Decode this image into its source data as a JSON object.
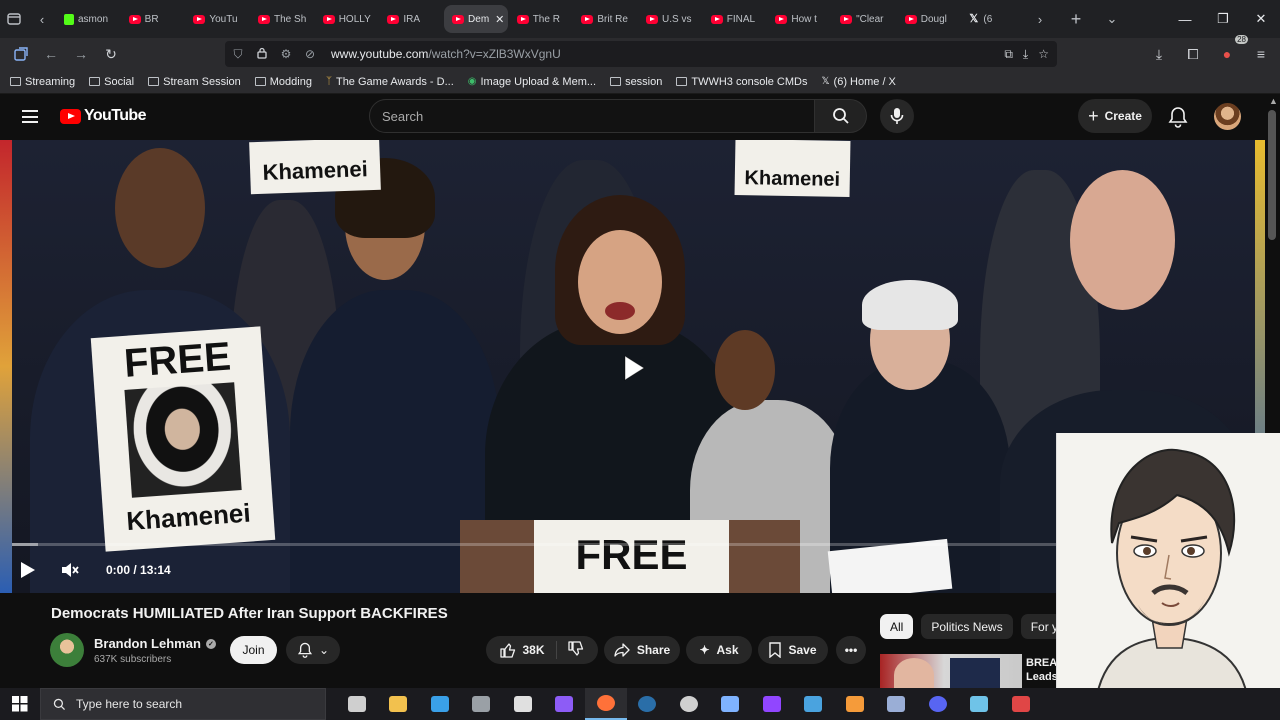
{
  "browser": {
    "tabs": [
      {
        "label": "asmon",
        "favicon": "kick-icon"
      },
      {
        "label": "BR",
        "favicon": "youtube-icon"
      },
      {
        "label": "YouTu",
        "favicon": "youtube-icon"
      },
      {
        "label": "The Sh",
        "favicon": "youtube-icon"
      },
      {
        "label": "HOLLY",
        "favicon": "youtube-icon"
      },
      {
        "label": "IRA",
        "favicon": "youtube-icon"
      },
      {
        "label": "Dem",
        "favicon": "youtube-icon",
        "active": true
      },
      {
        "label": "The R",
        "favicon": "youtube-icon"
      },
      {
        "label": "Brit Re",
        "favicon": "youtube-icon"
      },
      {
        "label": "U.S vs",
        "favicon": "youtube-icon"
      },
      {
        "label": "FINAL",
        "favicon": "youtube-icon"
      },
      {
        "label": "How t",
        "favicon": "youtube-icon"
      },
      {
        "label": "\"Clear",
        "favicon": "youtube-icon"
      },
      {
        "label": "Dougl",
        "favicon": "youtube-icon"
      },
      {
        "label": "(6",
        "favicon": "x-icon"
      }
    ],
    "url_host": "www.youtube.com",
    "url_path": "/watch?v=xZlB3WxVgnU",
    "extension_badge": "28",
    "bookmarks": [
      {
        "label": "Streaming",
        "icon": "folder-icon"
      },
      {
        "label": "Social",
        "icon": "folder-icon"
      },
      {
        "label": "Stream Session",
        "icon": "folder-icon"
      },
      {
        "label": "Modding",
        "icon": "folder-icon"
      },
      {
        "label": "The Game Awards - D...",
        "icon": "game-awards-icon"
      },
      {
        "label": "Image Upload & Mem...",
        "icon": "image-upload-icon"
      },
      {
        "label": "session",
        "icon": "folder-icon"
      },
      {
        "label": "TWWH3 console CMDs",
        "icon": "folder-icon"
      },
      {
        "label": "(6) Home / X",
        "icon": "x-icon"
      }
    ]
  },
  "youtube": {
    "logo_text": "YouTube",
    "search_placeholder": "Search",
    "create_label": "Create",
    "video": {
      "time_display": "0:00 / 13:14",
      "progress_fraction": 0.0,
      "sign_top_left": "Khamenei",
      "sign_top_right": "Khamenei",
      "sign_main_word": "FREE",
      "sign_main_name": "Khamenei",
      "podium_word": "FREE"
    },
    "title": "Democrats HUMILIATED After Iran Support BACKFIRES",
    "channel": {
      "name": "Brandon Lehman",
      "subscribers": "637K subscribers",
      "join_label": "Join"
    },
    "actions": {
      "likes": "38K",
      "share": "Share",
      "ask": "Ask",
      "save": "Save"
    },
    "chips": [
      "All",
      "Politics News",
      "For y"
    ],
    "recommended": {
      "title_line1": "BREA",
      "title_line2": "Leads"
    }
  },
  "taskbar": {
    "search_placeholder": "Type here to search"
  },
  "colors": {
    "youtube_red": "#ff0000",
    "page_bg": "#0f0f0f",
    "chip_active": "#f1f1f1"
  }
}
